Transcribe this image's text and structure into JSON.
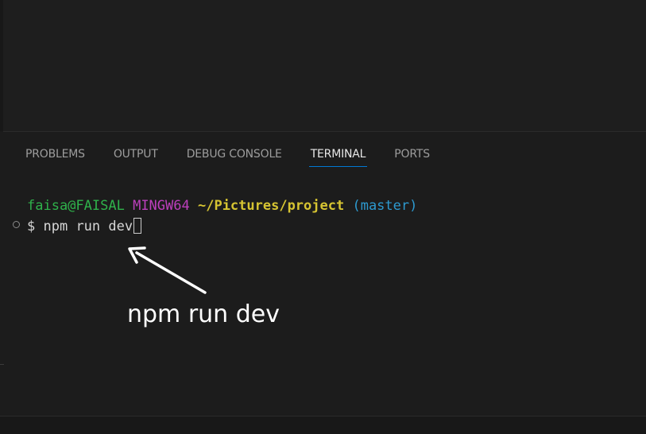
{
  "panel": {
    "tabs": [
      {
        "label": "PROBLEMS",
        "active": false
      },
      {
        "label": "OUTPUT",
        "active": false
      },
      {
        "label": "DEBUG CONSOLE",
        "active": false
      },
      {
        "label": "TERMINAL",
        "active": true
      },
      {
        "label": "PORTS",
        "active": false
      }
    ]
  },
  "terminal": {
    "user_host": "faisa@FAISAL",
    "system": "MINGW64",
    "path": "~/Pictures/project",
    "branch": "(master)",
    "prompt_symbol": "$",
    "command": "npm run dev"
  },
  "annotation": {
    "text": "npm run dev"
  },
  "colors": {
    "user_host": "#2fb24b",
    "system": "#bc3fbc",
    "path": "#d6c432",
    "branch": "#2d9ad0",
    "active_tab_underline": "#0078d4"
  }
}
